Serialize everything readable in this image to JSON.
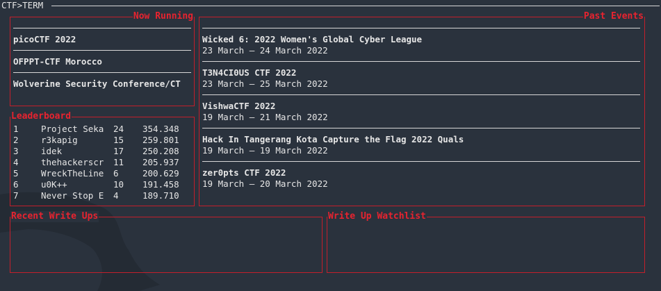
{
  "app": {
    "title": "CTF>TERM"
  },
  "now_running": {
    "title": "Now Running",
    "items": [
      {
        "name": "picoCTF 2022"
      },
      {
        "name": "OFPPT-CTF Morocco"
      },
      {
        "name": "Wolverine Security Conference/CT"
      }
    ]
  },
  "leaderboard": {
    "title": "Leaderboard",
    "rows": [
      {
        "rank": "1",
        "team": "Project Seka",
        "count": "24",
        "score": "354.348"
      },
      {
        "rank": "2",
        "team": "r3kapig",
        "count": "15",
        "score": "259.801"
      },
      {
        "rank": "3",
        "team": "idek",
        "count": "17",
        "score": "250.208"
      },
      {
        "rank": "4",
        "team": "thehackerscr",
        "count": "11",
        "score": "205.937"
      },
      {
        "rank": "5",
        "team": "WreckTheLine",
        "count": "6",
        "score": "200.629"
      },
      {
        "rank": "6",
        "team": "u0K++",
        "count": "10",
        "score": "191.458"
      },
      {
        "rank": "7",
        "team": "Never Stop E",
        "count": "4",
        "score": "189.710"
      }
    ]
  },
  "past_events": {
    "title": "Past Events",
    "items": [
      {
        "name": "Wicked 6: 2022 Women's Global Cyber League",
        "dates": "23 March — 24 March 2022"
      },
      {
        "name": "T3N4CI0US CTF 2022",
        "dates": "23 March — 25 March 2022"
      },
      {
        "name": "VishwaCTF 2022",
        "dates": "19 March — 21 March 2022"
      },
      {
        "name": "Hack In Tangerang Kota Capture the Flag 2022 Quals",
        "dates": "19 March — 19 March 2022"
      },
      {
        "name": "zer0pts CTF 2022",
        "dates": "19 March — 20 March 2022"
      }
    ]
  },
  "recent_writeups": {
    "title": "Recent Write Ups"
  },
  "watchlist": {
    "title": "Write Up Watchlist"
  },
  "colors": {
    "background": "#2a323d",
    "accent": "#e8232f",
    "border": "#c41f2b",
    "text": "#e6e6e6"
  }
}
